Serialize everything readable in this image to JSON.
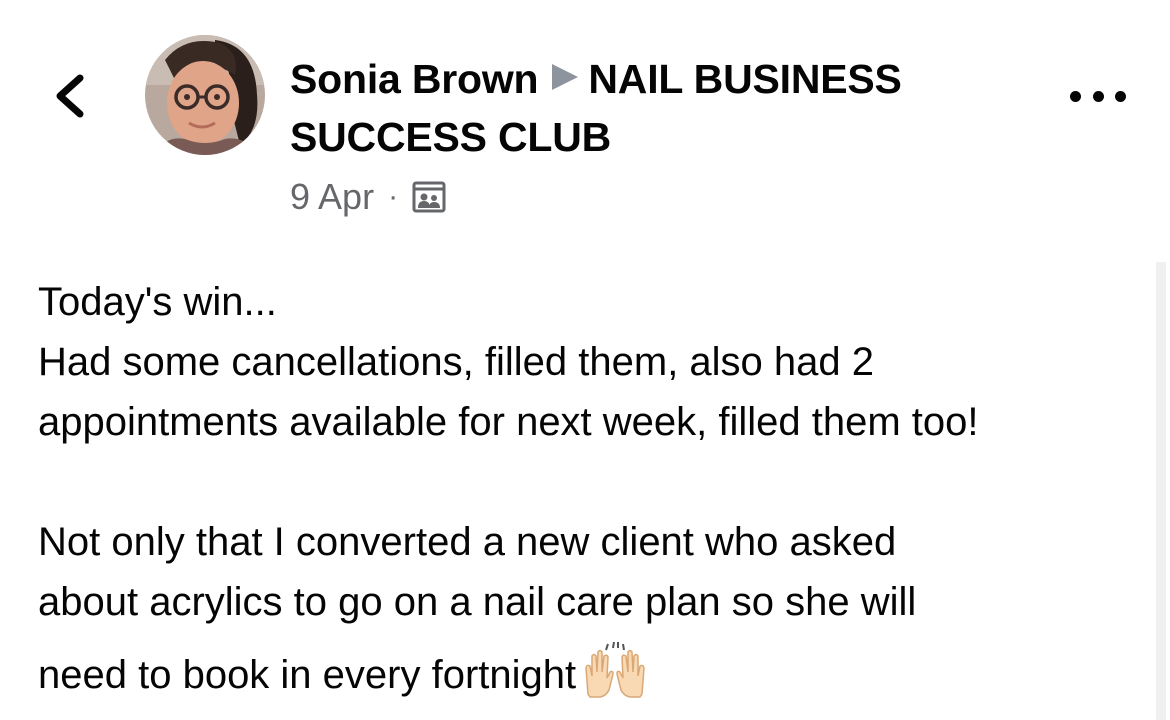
{
  "post": {
    "author": "Sonia Brown",
    "group_line1": "NAIL BUSINESS",
    "group_line2": "SUCCESS CLUB",
    "date": "9 Apr",
    "separator": "·",
    "privacy_icon": "group-members-icon",
    "body": {
      "line1": "Today's win...",
      "line2": "Had some cancellations, filled them, also had 2",
      "line3": "appointments available for next week, filled them too!",
      "line4": "Not only that I converted a new client who asked",
      "line5": "about acrylics to go on a nail care plan so she will",
      "line6": "need to book in every fortnight",
      "emoji": "raising-hands-emoji"
    }
  },
  "icons": {
    "back": "chevron-left-icon",
    "more": "more-options-icon",
    "arrow": "triangle-right-icon"
  },
  "colors": {
    "text": "#050505",
    "secondary": "#65676b",
    "arrow": "#8d949e",
    "background": "#ffffff"
  }
}
